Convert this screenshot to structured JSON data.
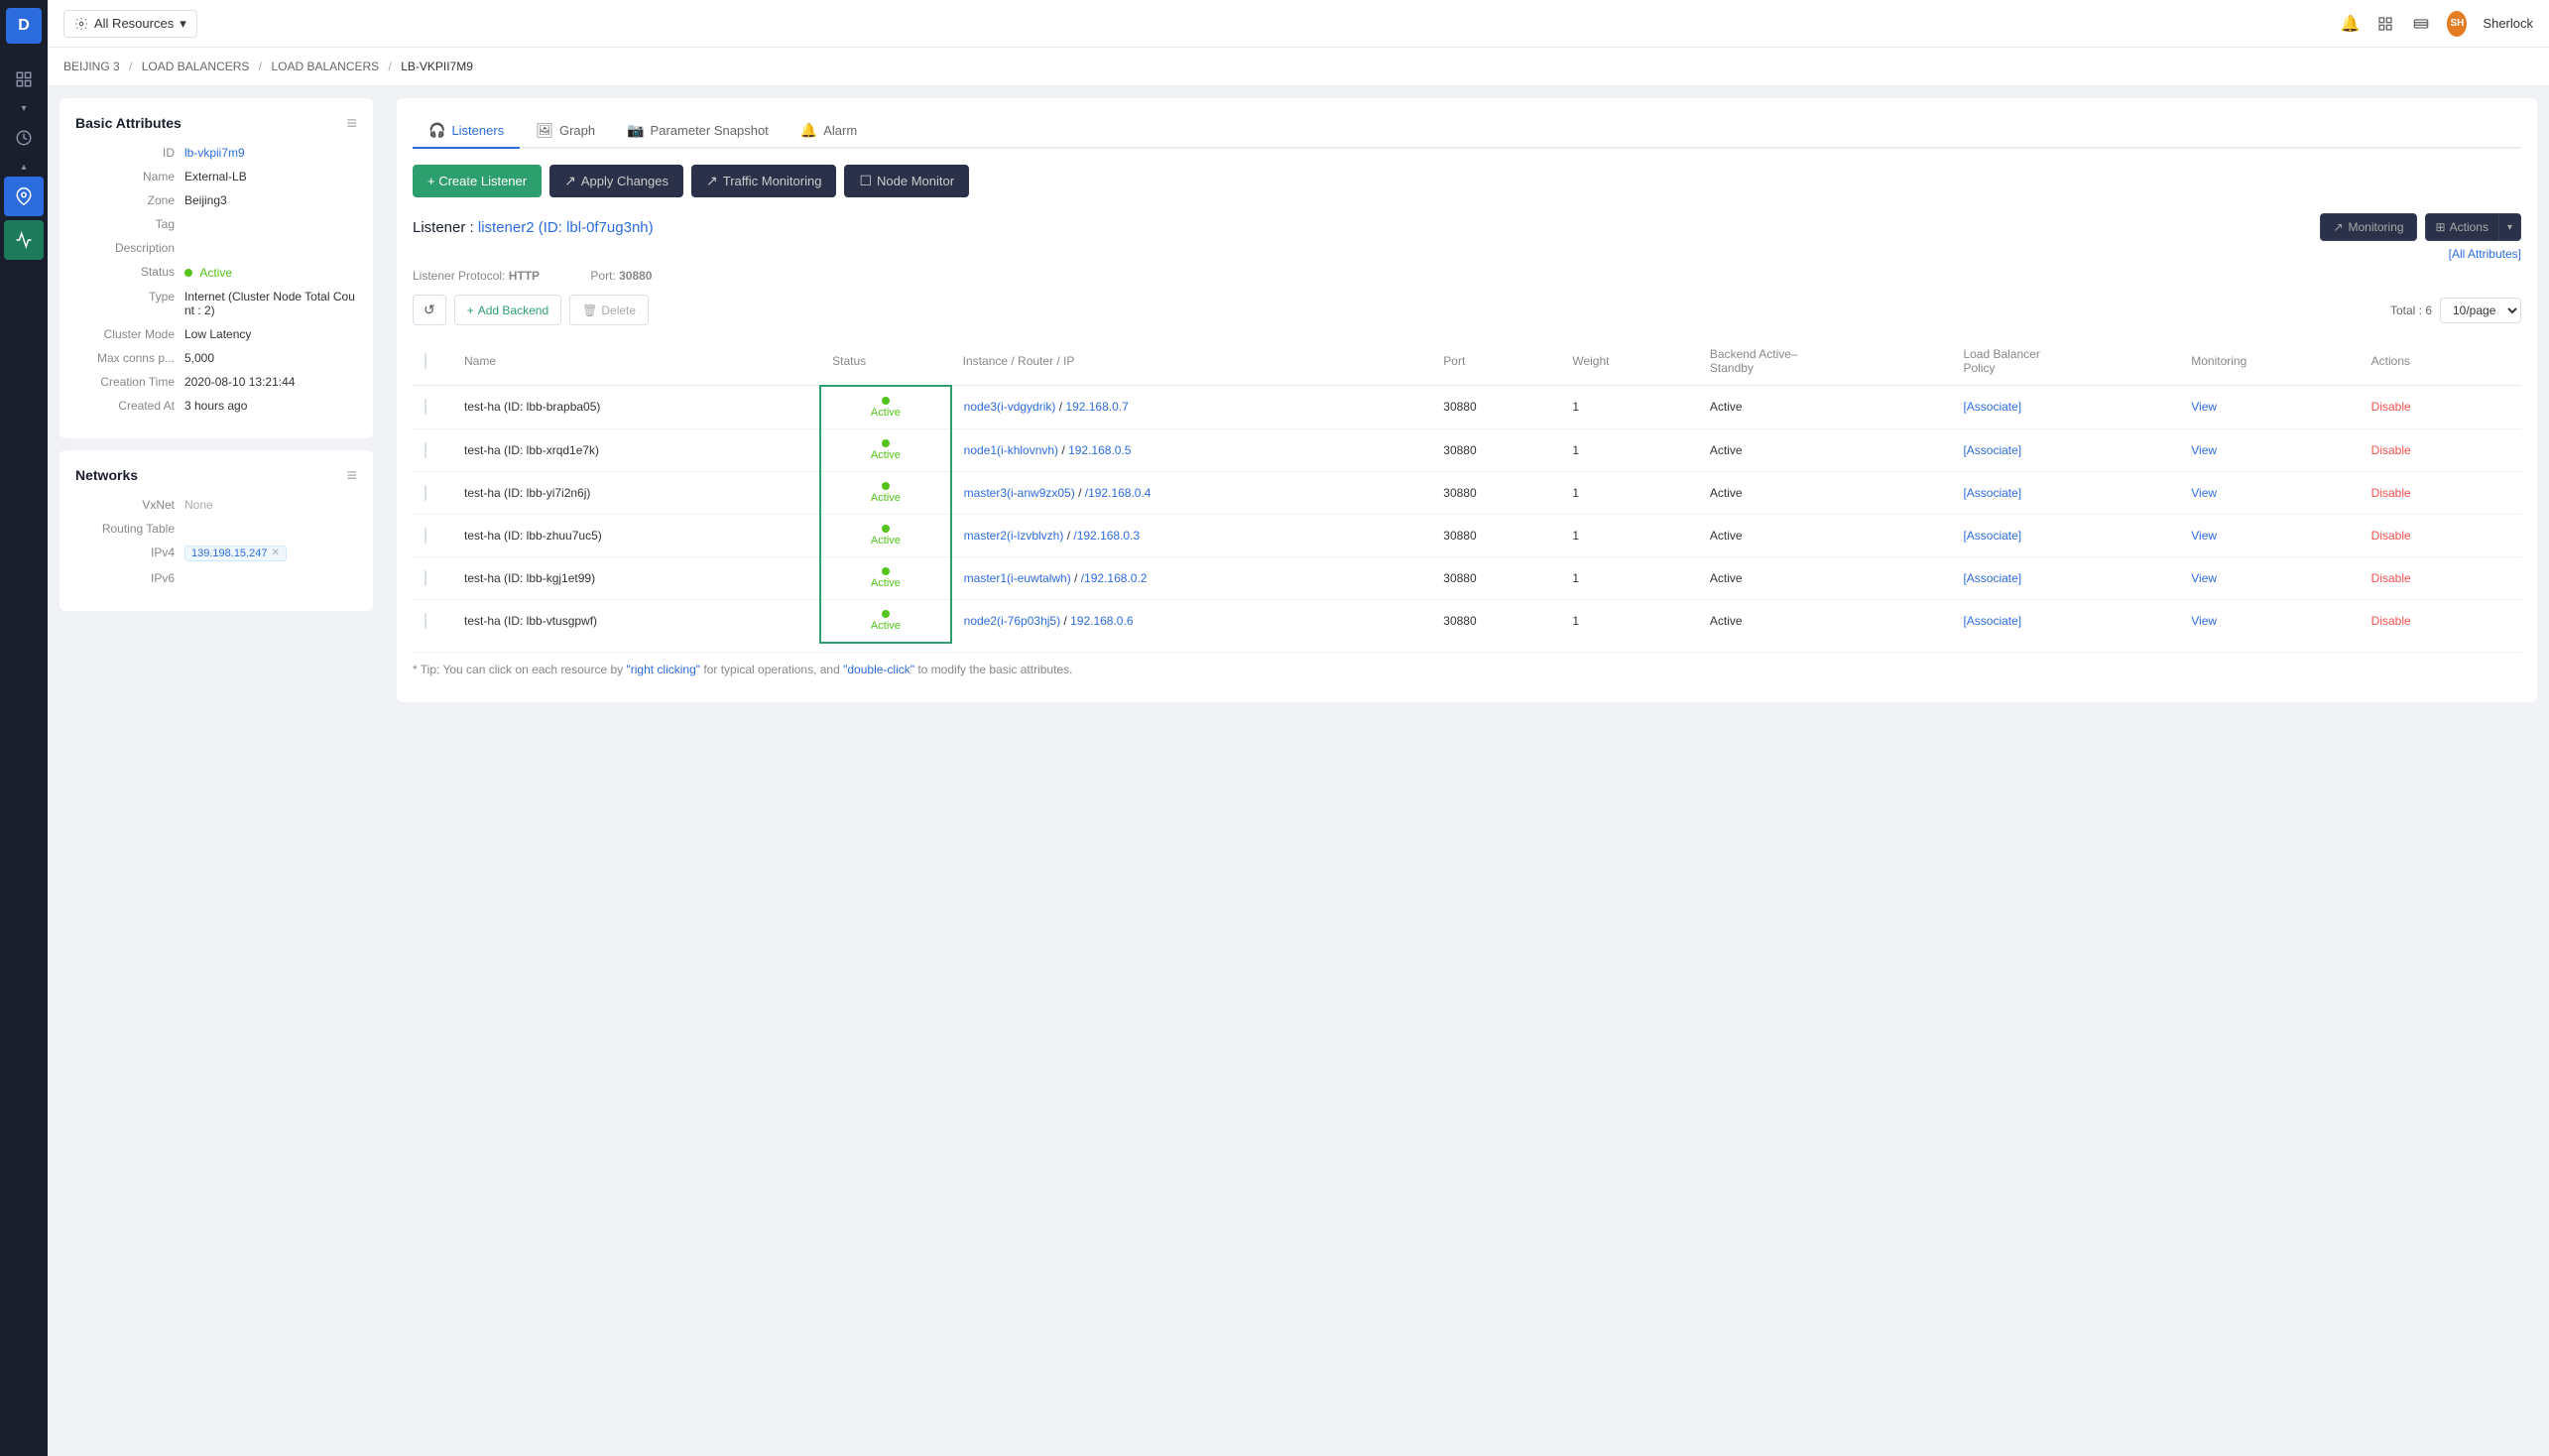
{
  "topbar": {
    "resource_selector": "All Resources",
    "user_name": "Sherlock",
    "user_initials": "SH"
  },
  "breadcrumb": {
    "items": [
      "BEIJING 3",
      "LOAD BALANCERS",
      "LOAD BALANCERS",
      "LB-VKPII7M9"
    ],
    "separators": [
      "/",
      "/",
      "/"
    ]
  },
  "left_panel": {
    "basic_attributes": {
      "title": "Basic Attributes",
      "fields": [
        {
          "label": "ID",
          "value": "lb-vkpii7m9",
          "type": "link"
        },
        {
          "label": "Name",
          "value": "External-LB",
          "type": "text"
        },
        {
          "label": "Zone",
          "value": "Beijing3",
          "type": "text"
        },
        {
          "label": "Tag",
          "value": "",
          "type": "text"
        },
        {
          "label": "Description",
          "value": "",
          "type": "text"
        },
        {
          "label": "Status",
          "value": "Active",
          "type": "status"
        },
        {
          "label": "Type",
          "value": "Internet (Cluster Node Total Count : 2)",
          "type": "text"
        },
        {
          "label": "Cluster Mode",
          "value": "Low Latency",
          "type": "text"
        },
        {
          "label": "Max conns p...",
          "value": "5,000",
          "type": "text"
        },
        {
          "label": "Creation Time",
          "value": "2020-08-10 13:21:44",
          "type": "text"
        },
        {
          "label": "Created At",
          "value": "3 hours ago",
          "type": "text"
        }
      ]
    },
    "networks": {
      "title": "Networks",
      "fields": [
        {
          "label": "VxNet",
          "value": "None",
          "type": "muted"
        },
        {
          "label": "Routing Table",
          "value": "",
          "type": "text"
        },
        {
          "label": "IPv4",
          "value": "139.198.15.247",
          "type": "ip"
        },
        {
          "label": "IPv6",
          "value": "",
          "type": "text"
        }
      ]
    }
  },
  "right_panel": {
    "tabs": [
      {
        "id": "listeners",
        "label": "Listeners",
        "icon": "🎧",
        "active": true
      },
      {
        "id": "graph",
        "label": "Graph",
        "icon": "🖼"
      },
      {
        "id": "parameter-snapshot",
        "label": "Parameter Snapshot",
        "icon": "📷"
      },
      {
        "id": "alarm",
        "label": "Alarm",
        "icon": "🔔"
      }
    ],
    "action_buttons": [
      {
        "id": "create-listener",
        "label": "+ Create Listener",
        "type": "primary"
      },
      {
        "id": "apply-changes",
        "label": "↗ Apply Changes",
        "type": "dark"
      },
      {
        "id": "traffic-monitoring",
        "label": "↗ Traffic Monitoring",
        "type": "dark"
      },
      {
        "id": "node-monitor",
        "label": "☐ Node Monitor",
        "type": "dark"
      }
    ],
    "listener": {
      "title": "Listener : listener2 (ID: lbl-0f7ug3nh)",
      "protocol_label": "Listener Protocol:",
      "protocol_value": "HTTP",
      "port_label": "Port:",
      "port_value": "30880",
      "monitoring_btn": "Monitoring",
      "actions_btn": "Actions",
      "all_attributes": "[All Attributes]",
      "total_label": "Total : 6",
      "per_page": "10/page",
      "add_backend": "+ Add Backend",
      "delete_btn": "Delete"
    },
    "table": {
      "columns": [
        "Name",
        "Status",
        "Instance / Router / IP",
        "Port",
        "Weight",
        "Backend Active–Standby",
        "Load Balancer Policy",
        "Monitoring",
        "Actions"
      ],
      "rows": [
        {
          "name": "test-ha (ID: lbb-brapba05)",
          "status": "Active",
          "instance": "node3(i-vdgydrik) / 192.168.0.7",
          "instance_parts": [
            "node3(i-vdgydrik)",
            "192.168.0.7"
          ],
          "port": "30880",
          "weight": "1",
          "backend_active": "Active",
          "lb_policy": "",
          "monitoring": "View",
          "actions": "Disable"
        },
        {
          "name": "test-ha (ID: lbb-xrqd1e7k)",
          "status": "Active",
          "instance": "node1(i-khlovnvh) / 192.168.0.5",
          "instance_parts": [
            "node1(i-khlovnvh)",
            "192.168.0.5"
          ],
          "port": "30880",
          "weight": "1",
          "backend_active": "Active",
          "lb_policy": "",
          "monitoring": "View",
          "actions": "Disable"
        },
        {
          "name": "test-ha (ID: lbb-yi7i2n6j)",
          "status": "Active",
          "instance": "master3(i-anw9zx05) /192.168.0.4",
          "instance_parts": [
            "master3(i-anw9zx05)",
            "/192.168.0.4"
          ],
          "port": "30880",
          "weight": "1",
          "backend_active": "Active",
          "lb_policy": "",
          "monitoring": "View",
          "actions": "Disable"
        },
        {
          "name": "test-ha (ID: lbb-zhuu7uc5)",
          "status": "Active",
          "instance": "master2(i-lzvblvzh) /192.168.0.3",
          "instance_parts": [
            "master2(i-lzvblvzh)",
            "/192.168.0.3"
          ],
          "port": "30880",
          "weight": "1",
          "backend_active": "Active",
          "lb_policy": "",
          "monitoring": "View",
          "actions": "Disable"
        },
        {
          "name": "test-ha (ID: lbb-kgj1et99)",
          "status": "Active",
          "instance": "master1(i-euwtalwh) /192.168.0.2",
          "instance_parts": [
            "master1(i-euwtalwh)",
            "/192.168.0.2"
          ],
          "port": "30880",
          "weight": "1",
          "backend_active": "Active",
          "lb_policy": "",
          "monitoring": "View",
          "actions": "Disable"
        },
        {
          "name": "test-ha (ID: lbb-vtusgpwf)",
          "status": "Active",
          "instance": "node2(i-76p03hj5) / 192.168.0.6",
          "instance_parts": [
            "node2(i-76p03hj5)",
            "192.168.0.6"
          ],
          "port": "30880",
          "weight": "1",
          "backend_active": "Active",
          "lb_policy": "",
          "monitoring": "View",
          "actions": "Disable"
        }
      ]
    },
    "tip": {
      "text": "* Tip: You can click on each resource by ",
      "right_click_text": "\"right clicking\"",
      "mid_text": " for typical operations, and ",
      "double_click_text": "\"double-click\"",
      "end_text": " to modify the basic attributes."
    }
  },
  "icons": {
    "menu": "≡",
    "chevron_down": "▾",
    "chevron_up": "▴",
    "bell": "🔔",
    "grid": "⊞",
    "refresh": "↺",
    "plus": "+",
    "trash": "🗑",
    "trending": "↗",
    "monitor": "☐",
    "headphone": "🎧"
  }
}
